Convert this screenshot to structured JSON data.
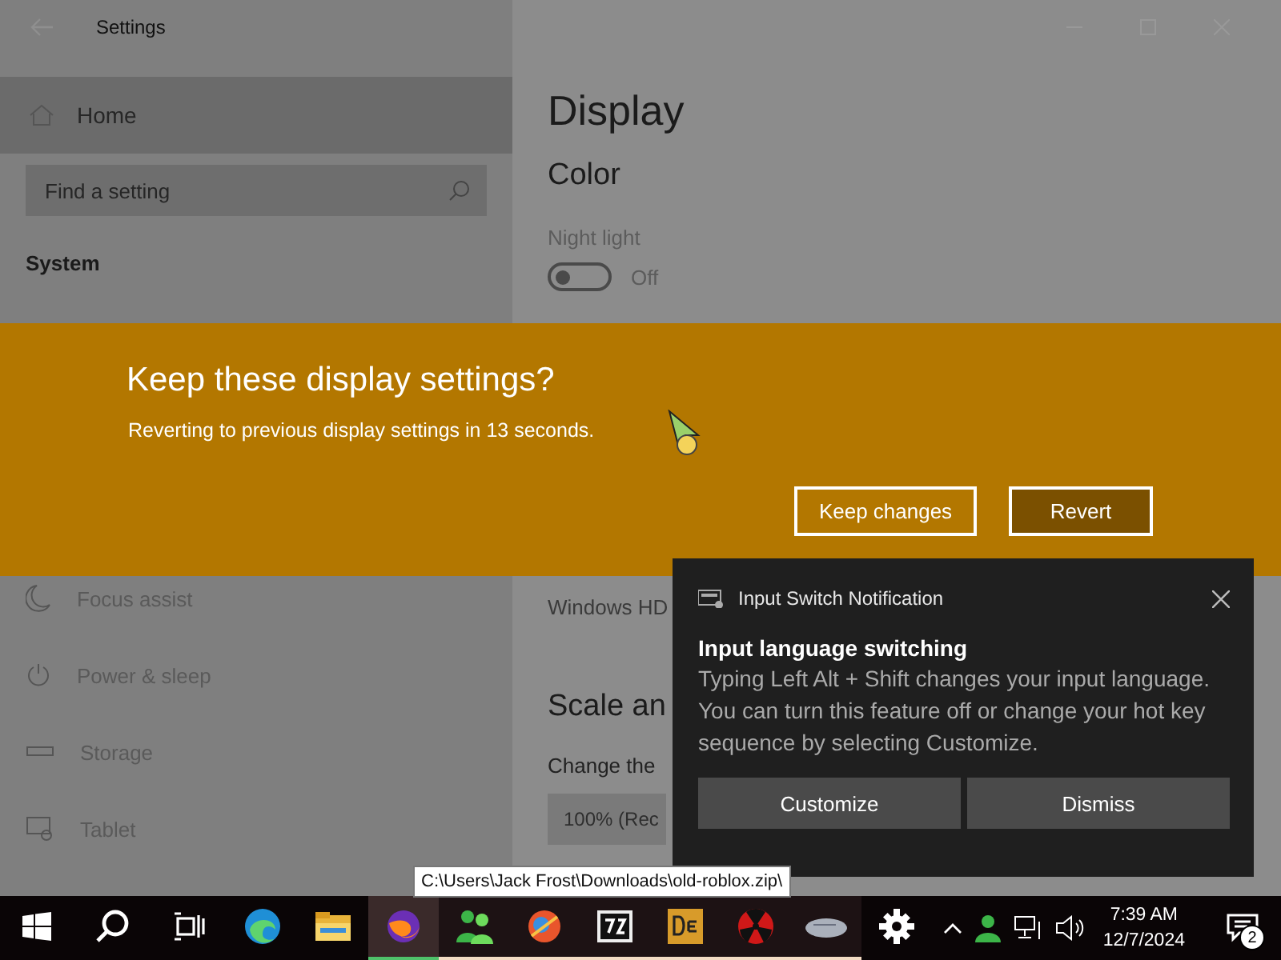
{
  "window": {
    "title": "Settings"
  },
  "sidebar": {
    "home": "Home",
    "search": {
      "placeholder": "Find a setting"
    },
    "section": "System",
    "items": [
      {
        "label": "Focus assist",
        "selected": false
      },
      {
        "label": "Power & sleep",
        "selected": false
      },
      {
        "label": "Storage",
        "selected": false
      },
      {
        "label": "Tablet",
        "selected": false
      }
    ]
  },
  "content": {
    "title": "Display",
    "section": "Color",
    "night_light": {
      "label": "Night light",
      "on": false,
      "state": "Off"
    },
    "hdr_text": "Windows HD",
    "scale_heading": "Scale an",
    "scale_label": "Change the",
    "scale_value": "100% (Rec"
  },
  "dialog": {
    "title": "Keep these display settings?",
    "message": "Reverting to previous display settings in 13 seconds.",
    "buttons": [
      {
        "label": "Keep changes",
        "selected": false
      },
      {
        "label": "Revert",
        "selected": true
      }
    ]
  },
  "notification": {
    "app": "Input Switch Notification",
    "title": "Input language switching",
    "body": "Typing Left Alt + Shift changes your input language. You can turn this feature off or change your hot key sequence by selecting Customize.",
    "buttons": [
      "Customize",
      "Dismiss"
    ]
  },
  "tooltip": "C:\\Users\\Jack Frost\\Downloads\\old-roblox.zip\\",
  "taskbar": {
    "apps": [
      {
        "running": false,
        "selected": false
      },
      {
        "running": false,
        "selected": false
      },
      {
        "running": false,
        "selected": false
      },
      {
        "running": false,
        "selected": false
      },
      {
        "running": true,
        "selected": true
      },
      {
        "running": true,
        "selected": false
      },
      {
        "running": true,
        "selected": false
      },
      {
        "running": true,
        "selected": false
      },
      {
        "running": true,
        "selected": false
      },
      {
        "running": true,
        "selected": false
      },
      {
        "running": true,
        "selected": false
      },
      {
        "running": false,
        "selected": false
      }
    ],
    "time": "7:39 AM",
    "date": "12/7/2024",
    "notifications": "2"
  }
}
